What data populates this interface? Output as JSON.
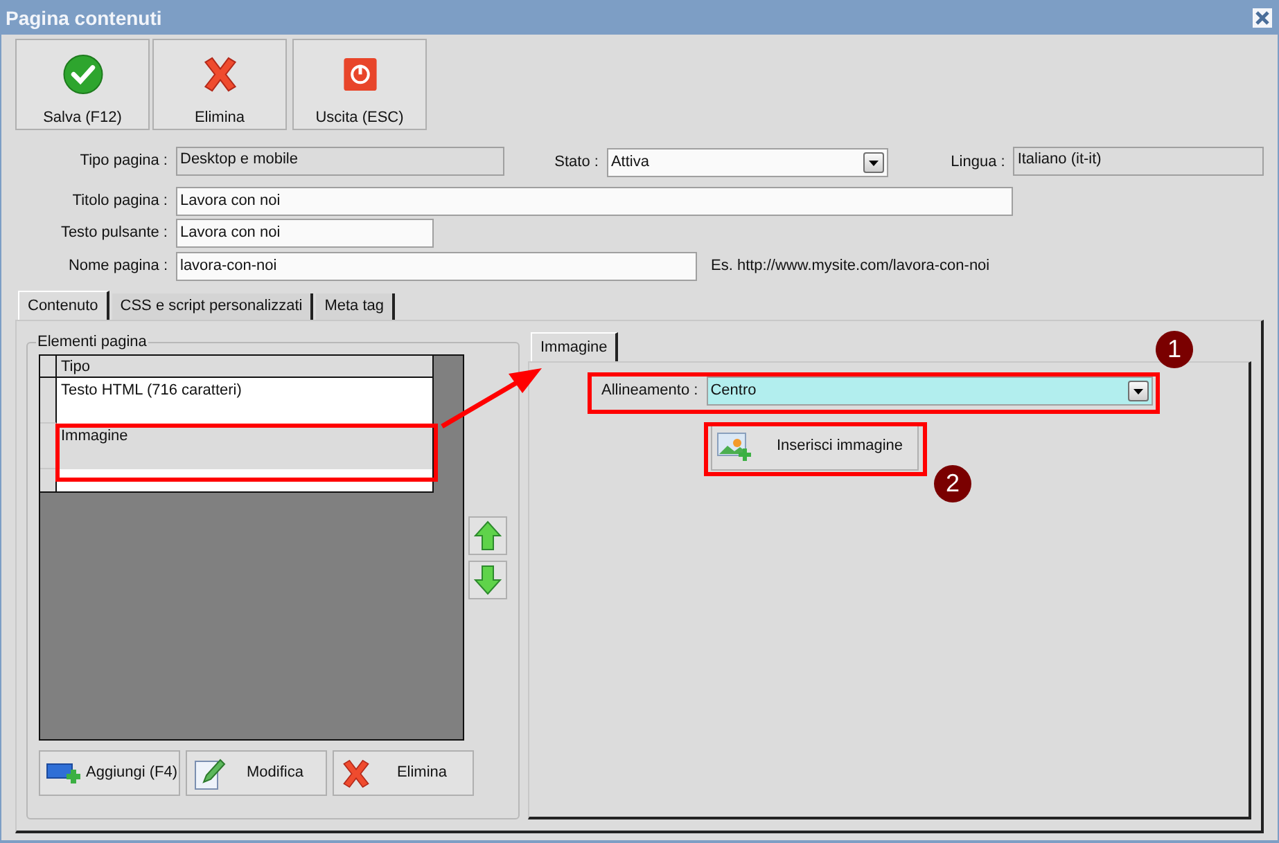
{
  "window": {
    "title": "Pagina contenuti"
  },
  "toolbar": [
    {
      "label": "Salva (F12)",
      "kind": "save"
    },
    {
      "label": "Elimina",
      "kind": "delete"
    },
    {
      "label": "Uscita (ESC)",
      "kind": "exit"
    }
  ],
  "form": {
    "tipo_pagina": {
      "label": "Tipo pagina :",
      "value": "Desktop e mobile"
    },
    "stato": {
      "label": "Stato :",
      "value": "Attiva"
    },
    "lingua": {
      "label": "Lingua :",
      "value": "Italiano (it-it)"
    },
    "titolo_pagina": {
      "label": "Titolo pagina :",
      "value": "Lavora con noi"
    },
    "testo_pulsante": {
      "label": "Testo pulsante :",
      "value": "Lavora con noi"
    },
    "nome_pagina": {
      "label": "Nome pagina :",
      "value": "lavora-con-noi",
      "hint": "Es. http://www.mysite.com/lavora-con-noi"
    }
  },
  "tabs": [
    {
      "label": "Contenuto",
      "selected": true
    },
    {
      "label": "CSS e script personalizzati",
      "selected": false
    },
    {
      "label": "Meta tag",
      "selected": false
    }
  ],
  "elements_group": {
    "title": "Elementi pagina",
    "columns": [
      "Tipo"
    ],
    "rows": [
      {
        "cells": [
          "Testo HTML (716 caratteri)"
        ],
        "selected": false
      },
      {
        "cells": [
          "Immagine"
        ],
        "selected": true
      }
    ],
    "buttons": [
      {
        "label": "Aggiungi (F4)",
        "kind": "add"
      },
      {
        "label": "Modifica",
        "kind": "edit"
      },
      {
        "label": "Elimina",
        "kind": "delete"
      }
    ]
  },
  "detail": {
    "tab": {
      "label": "Immagine",
      "selected": true
    },
    "alignment": {
      "label": "Allineamento :",
      "value": "Centro"
    },
    "insert_button": {
      "label": "Inserisci immagine"
    }
  },
  "markers": [
    {
      "label": "1"
    },
    {
      "label": "2"
    }
  ]
}
